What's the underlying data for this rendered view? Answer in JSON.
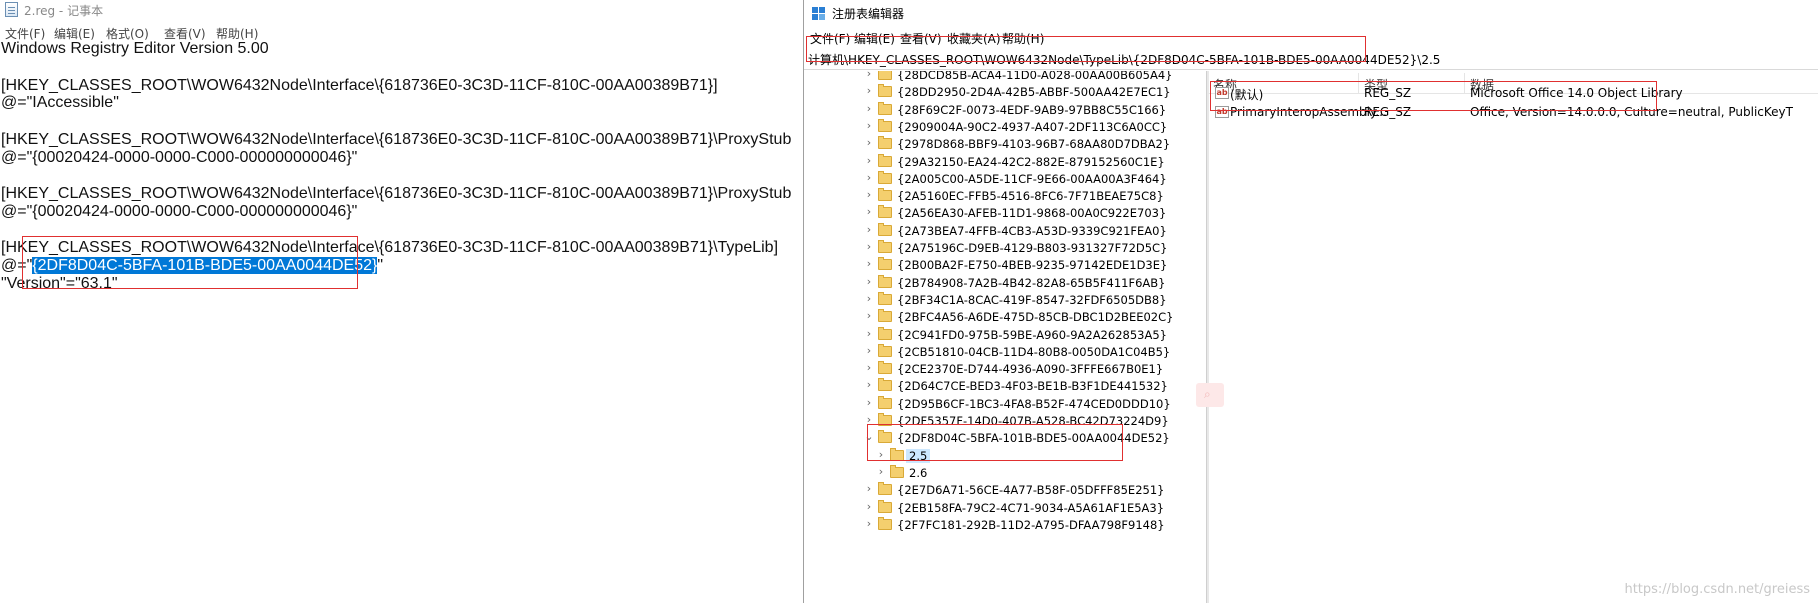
{
  "notepad": {
    "title": "2.reg - 记事本",
    "menu": [
      "文件(F)",
      "编辑(E)",
      "格式(O)",
      "查看(V)",
      "帮助(H)"
    ],
    "lines": [
      "Windows Registry Editor Version 5.00",
      "",
      "[HKEY_CLASSES_ROOT\\WOW6432Node\\Interface\\{618736E0-3C3D-11CF-810C-00AA00389B71}]",
      "@=\"IAccessible\"",
      "",
      "[HKEY_CLASSES_ROOT\\WOW6432Node\\Interface\\{618736E0-3C3D-11CF-810C-00AA00389B71}\\ProxyStub",
      "@=\"{00020424-0000-0000-C000-000000000046}\"",
      "",
      "[HKEY_CLASSES_ROOT\\WOW6432Node\\Interface\\{618736E0-3C3D-11CF-810C-00AA00389B71}\\ProxyStub",
      "@=\"{00020424-0000-0000-C000-000000000046}\"",
      "",
      "[HKEY_CLASSES_ROOT\\WOW6432Node\\Interface\\{618736E0-3C3D-11CF-810C-00AA00389B71}\\TypeLib]"
    ],
    "sel_line": {
      "prefix": "@=\"",
      "selected": "{2DF8D04C-5BFA-101B-BDE5-00AA0044DE52}",
      "suffix": "\""
    },
    "last_line": "\"Version\"=\"63.1\"",
    "selection_color": "#0078d7",
    "highlight_color": "#e03030"
  },
  "regedit": {
    "title": "注册表编辑器",
    "menu": [
      "文件(F)",
      "编辑(E)",
      "查看(V)",
      "收藏夹(A)",
      "帮助(H)"
    ],
    "address": "计算机\\HKEY_CLASSES_ROOT\\WOW6432Node\\TypeLib\\{2DF8D04C-5BFA-101B-BDE5-00AA0044DE52}\\2.5",
    "tree": [
      {
        "label": "{28DCD85B-ACA4-11D0-A028-00AA00B605A4}",
        "level": 0,
        "expander": "›"
      },
      {
        "label": "{28DD2950-2D4A-42B5-ABBF-500AA42E7EC1}",
        "level": 0,
        "expander": "›"
      },
      {
        "label": "{28F69C2F-0073-4EDF-9AB9-97BB8C55C166}",
        "level": 0,
        "expander": "›"
      },
      {
        "label": "{2909004A-90C2-4937-A407-2DF113C6A0CC}",
        "level": 0,
        "expander": "›"
      },
      {
        "label": "{2978D868-BBF9-4103-96B7-68AA80D7DBA2}",
        "level": 0,
        "expander": "›"
      },
      {
        "label": "{29A32150-EA24-42C2-882E-879152560C1E}",
        "level": 0,
        "expander": "›"
      },
      {
        "label": "{2A005C00-A5DE-11CF-9E66-00AA00A3F464}",
        "level": 0,
        "expander": "›"
      },
      {
        "label": "{2A5160EC-FFB5-4516-8FC6-7F71BEAE75C8}",
        "level": 0,
        "expander": "›"
      },
      {
        "label": "{2A56EA30-AFEB-11D1-9868-00A0C922E703}",
        "level": 0,
        "expander": "›"
      },
      {
        "label": "{2A73BEA7-4FFB-4CB3-A53D-9339C921FEA0}",
        "level": 0,
        "expander": "›"
      },
      {
        "label": "{2A75196C-D9EB-4129-B803-931327F72D5C}",
        "level": 0,
        "expander": "›"
      },
      {
        "label": "{2B00BA2F-E750-4BEB-9235-97142EDE1D3E}",
        "level": 0,
        "expander": "›"
      },
      {
        "label": "{2B784908-7A2B-4B42-82A8-65B5F411F6AB}",
        "level": 0,
        "expander": "›"
      },
      {
        "label": "{2BF34C1A-8CAC-419F-8547-32FDF6505DB8}",
        "level": 0,
        "expander": "›"
      },
      {
        "label": "{2BFC4A56-A6DE-475D-85CB-DBC1D2BEE02C}",
        "level": 0,
        "expander": "›"
      },
      {
        "label": "{2C941FD0-975B-59BE-A960-9A2A262853A5}",
        "level": 0,
        "expander": "›"
      },
      {
        "label": "{2CB51810-04CB-11D4-80B8-0050DA1C04B5}",
        "level": 0,
        "expander": "›"
      },
      {
        "label": "{2CE2370E-D744-4936-A090-3FFFE667B0E1}",
        "level": 0,
        "expander": "›"
      },
      {
        "label": "{2D64C7CE-BED3-4F03-BE1B-B3F1DE441532}",
        "level": 0,
        "expander": "›"
      },
      {
        "label": "{2D95B6CF-1BC3-4FA8-B52F-474CED0DDD10}",
        "level": 0,
        "expander": "›"
      },
      {
        "label": "{2DF5357F-14D0-407B-A528-BC42D73224D9}",
        "level": 0,
        "expander": "›"
      },
      {
        "label": "{2DF8D04C-5BFA-101B-BDE5-00AA0044DE52}",
        "level": 0,
        "expander": "⌄"
      },
      {
        "label": "2.5",
        "level": 1,
        "expander": "›",
        "selected": true
      },
      {
        "label": "2.6",
        "level": 1,
        "expander": "›"
      },
      {
        "label": "{2E7D6A71-56CE-4A77-B58F-05DFFF85E251}",
        "level": 0,
        "expander": "›"
      },
      {
        "label": "{2EB158FA-79C2-4C71-9034-A5A61AF1E5A3}",
        "level": 0,
        "expander": "›"
      },
      {
        "label": "{2F7FC181-292B-11D2-A795-DFAA798F9148}",
        "level": 0,
        "expander": "›"
      }
    ],
    "columns": [
      "名称",
      "类型",
      "数据"
    ],
    "values": [
      {
        "name": "(默认)",
        "type": "REG_SZ",
        "data": "Microsoft Office 14.0 Object Library"
      },
      {
        "name": "PrimaryInteropAssembly...",
        "type": "REG_SZ",
        "data": "Office, Version=14.0.0.0, Culture=neutral, PublicKeyT"
      }
    ],
    "value_icon_text": "ab"
  },
  "watermark": "https://blog.csdn.net/greiess"
}
